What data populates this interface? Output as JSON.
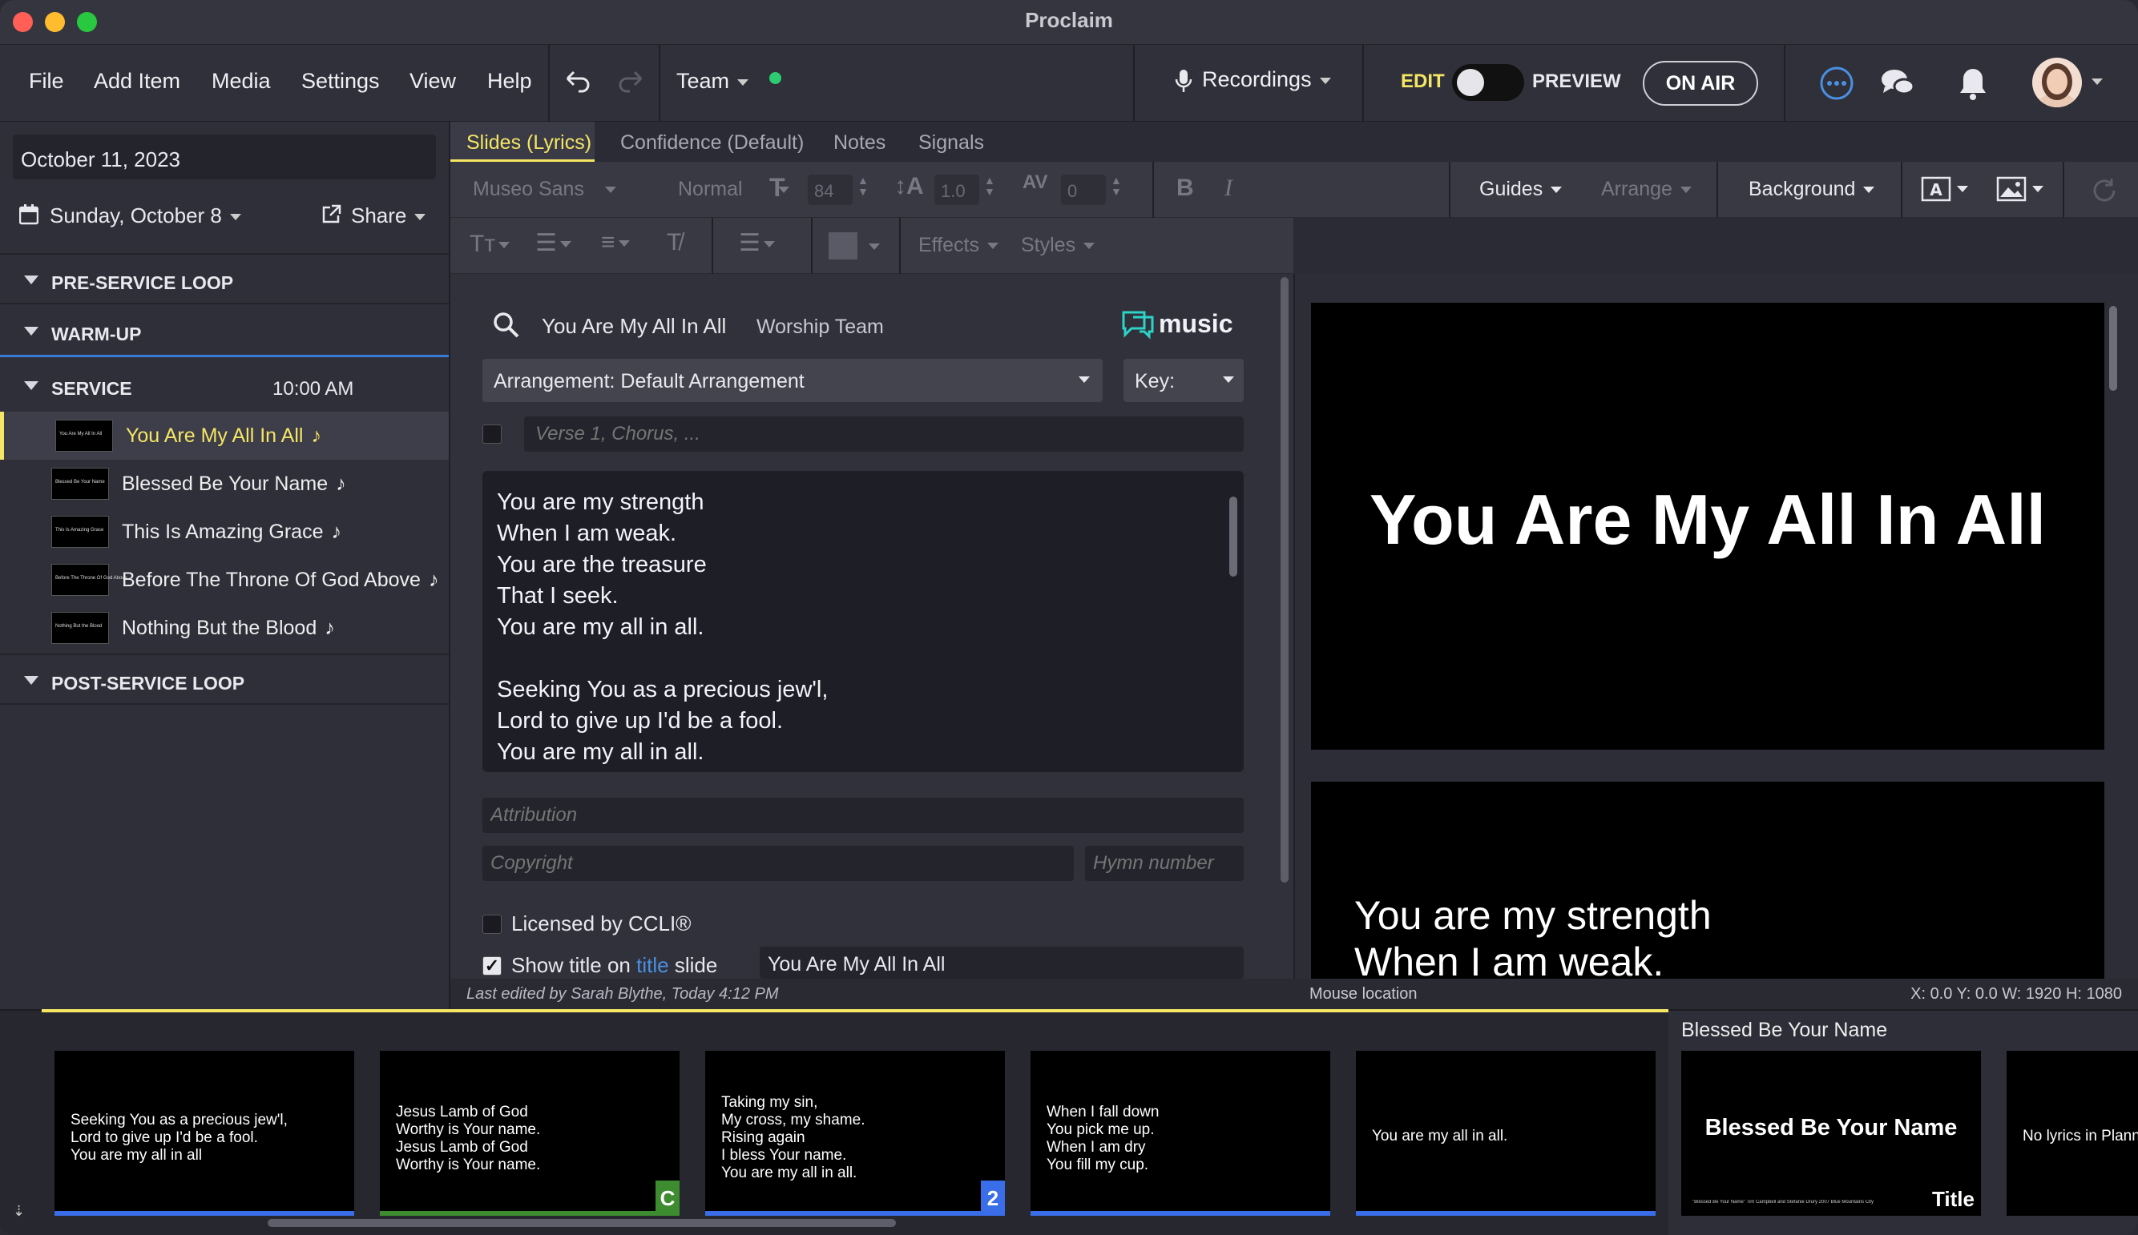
{
  "window": {
    "title": "Proclaim"
  },
  "menu": {
    "items": [
      "File",
      "Add Item",
      "Media",
      "Settings",
      "View",
      "Help"
    ],
    "team": "Team",
    "recordings": "Recordings",
    "edit": "EDIT",
    "preview": "PREVIEW",
    "on_air": "ON AIR"
  },
  "left": {
    "date": "October 11, 2023",
    "service_date": "Sunday, October 8",
    "share": "Share",
    "sections": {
      "pre": "PRE-SERVICE LOOP",
      "warm": "WARM-UP",
      "service": "SERVICE",
      "service_time": "10:00 AM",
      "post": "POST-SERVICE LOOP"
    },
    "songs": [
      {
        "name": "You Are My All In All",
        "thumb": "You Are My All In All"
      },
      {
        "name": "Blessed Be Your Name",
        "thumb": "Blessed Be Your Name"
      },
      {
        "name": "This Is Amazing Grace",
        "thumb": "This Is Amazing Grace"
      },
      {
        "name": "Before The Throne Of God Above",
        "thumb": "Before The Throne Of God Above"
      },
      {
        "name": "Nothing But the Blood",
        "thumb": "Nothing But the Blood"
      }
    ]
  },
  "tabs": [
    "Slides (Lyrics)",
    "Confidence (Default)",
    "Notes",
    "Signals"
  ],
  "format": {
    "font": "Museo Sans",
    "weight": "Normal",
    "size": "84",
    "line": "1.0",
    "spacing": "0",
    "guides": "Guides",
    "arrange": "Arrange",
    "background": "Background",
    "effects": "Effects",
    "styles": "Styles"
  },
  "song": {
    "search_title": "You Are My All In All",
    "author": "Worship Team",
    "music_logo": "music",
    "arrangement": "Arrangement: Default Arrangement",
    "key": "Key:",
    "sequence_placeholder": "Verse 1, Chorus, ...",
    "lyrics": [
      "You are my strength",
      "When I am weak.",
      "You are the treasure",
      "That I seek.",
      "You are my all in all.",
      "",
      "Seeking You as a precious jew'l,",
      "Lord to give up I'd be a fool.",
      "You are my all in all."
    ],
    "attribution_ph": "Attribution",
    "copyright_ph": "Copyright",
    "hymn_ph": "Hymn number",
    "ccli": "Licensed by CCLI®",
    "show_title_a": "Show title on",
    "show_title_link": "title",
    "show_title_b": "slide",
    "title_value": "You Are My All In All",
    "last_edited": "Last edited by Sarah Blythe, Today 4:12 PM"
  },
  "preview": {
    "main_title": "You Are My All In All",
    "slide2_lines": [
      "You are my strength",
      "When I am weak."
    ],
    "mouse_label": "Mouse location",
    "coords": "X: 0.0  Y: 0.0    W: 1920  H: 1080"
  },
  "strip": {
    "next_song": "Blessed Be Your Name",
    "slides": [
      {
        "text": "Seeking You as a precious jew'l,\nLord to give up I'd be a fool.\nYou are my all in all",
        "badge": ""
      },
      {
        "text": "Jesus Lamb of God\nWorthy is Your name.\nJesus Lamb of God\nWorthy is Your name.",
        "badge": "C"
      },
      {
        "text": "Taking my sin,\nMy cross, my shame.\nRising again\nI bless Your name.\nYou are my all in all.",
        "badge": "2"
      },
      {
        "text": "When I fall down\nYou pick me up.\nWhen I am dry\nYou fill my cup.",
        "badge": ""
      },
      {
        "text": "You are my all in all.",
        "badge": ""
      }
    ],
    "title_slide": "Blessed Be Your Name",
    "title_slide_credit": "\"Blessed Be Your Name\" Tim Campbell and Stefanie Drury 2007 Blue Mountains City",
    "title_slide_tag": "Title",
    "last_slide": "No lyrics in Planning"
  },
  "colors": {
    "accent": "#f5e663",
    "link": "#4a90e2",
    "chorus": "#3d8c2f",
    "verse": "#3a6ee8"
  }
}
